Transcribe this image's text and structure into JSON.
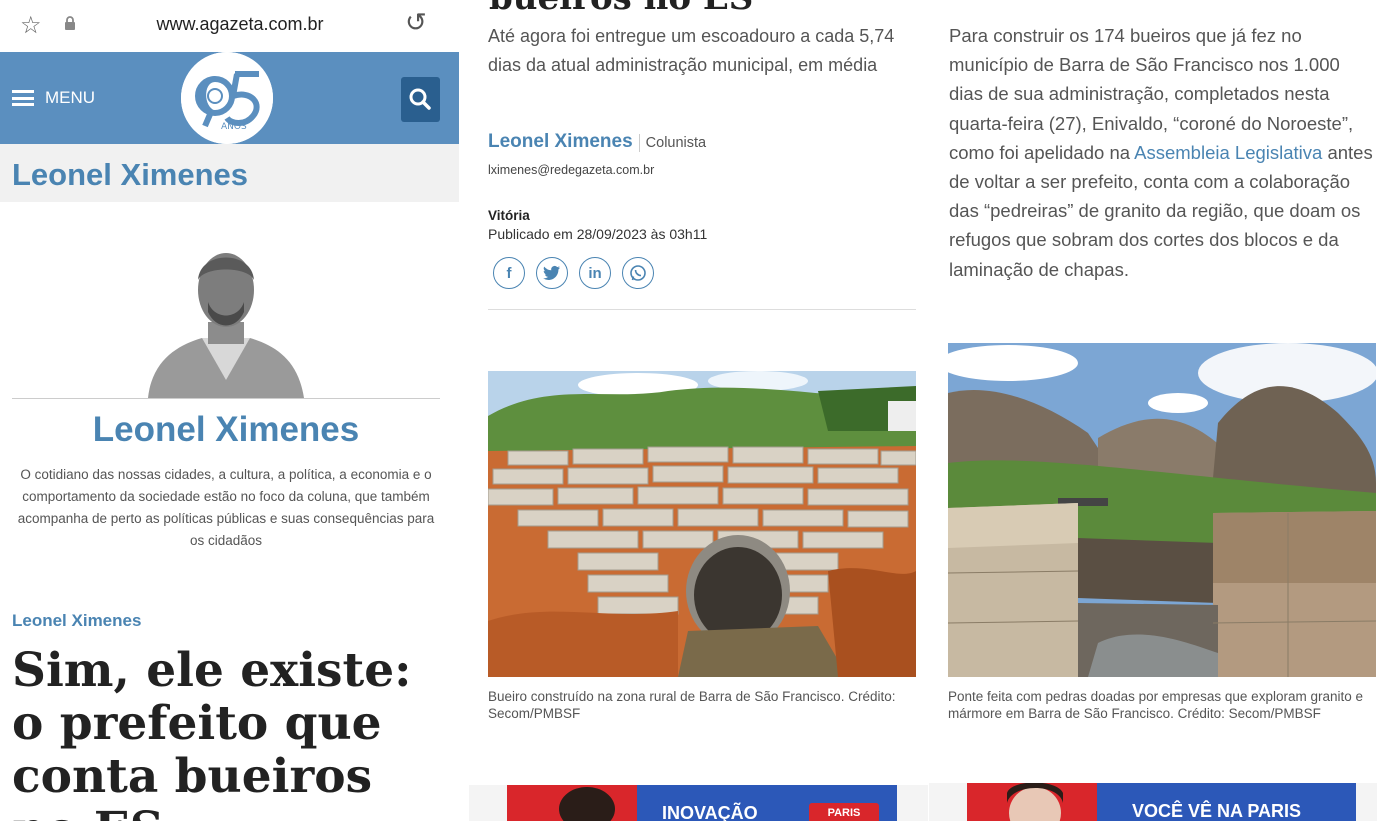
{
  "browser": {
    "url": "www.agazeta.com.br"
  },
  "header": {
    "menu_label": "MENU",
    "logo_anos": "ANOS"
  },
  "column": {
    "name_bar": "Leonel Ximenes",
    "author_name": "Leonel Ximenes",
    "bio": "O cotidiano das nossas cidades, a cultura, a política, a economia e o comportamento da sociedade estão no foco da coluna, que também acompanha de perto as políticas públicas e suas consequências para os cidadãos",
    "kicker": "Leonel Ximenes",
    "headline": "Sim, ele existe: o prefeito que conta bueiros no ES"
  },
  "article": {
    "title_tail": "bueiros no ES",
    "subtitle": "Até agora foi entregue um escoadouro a cada 5,74 dias da atual administração municipal, em média",
    "author": "Leonel Ximenes",
    "role": "Colunista",
    "email": "lximenes@redegazeta.com.br",
    "city": "Vitória",
    "published": "Publicado em 28/09/2023 às 03h11",
    "share": [
      "f",
      "t",
      "in",
      "w"
    ],
    "caption1": "Bueiro construído na zona rural de Barra de São Francisco. Crédito: Secom/PMBSF",
    "body_before": "Para construir os 174 bueiros que já fez no município de Barra de São Francisco nos 1.000 dias de sua administração, completados nesta quarta-feira (27), Enivaldo, “coroné do Noroeste”, como foi apelidado na ",
    "body_link": "Assembleia Legislativa",
    "body_after": " antes de voltar a ser prefeito, conta com a colaboração das “pedreiras” de granito da região, que doam os refugos que sobram dos cortes dos blocos e da laminação de chapas.",
    "caption2": "Ponte feita com pedras doadas por empresas que exploram granito e mármore em Barra de São Francisco. Crédito: Secom/PMBSF"
  },
  "ads": {
    "ad1_text": "INOVAÇÃO",
    "ad1_brand": "PARIS",
    "ad2_text": "VOCÊ VÊ NA PARIS"
  },
  "colors": {
    "brand_blue": "#5b8fbf",
    "link_blue": "#4a84b2",
    "dark_blue": "#2a5f8f"
  }
}
